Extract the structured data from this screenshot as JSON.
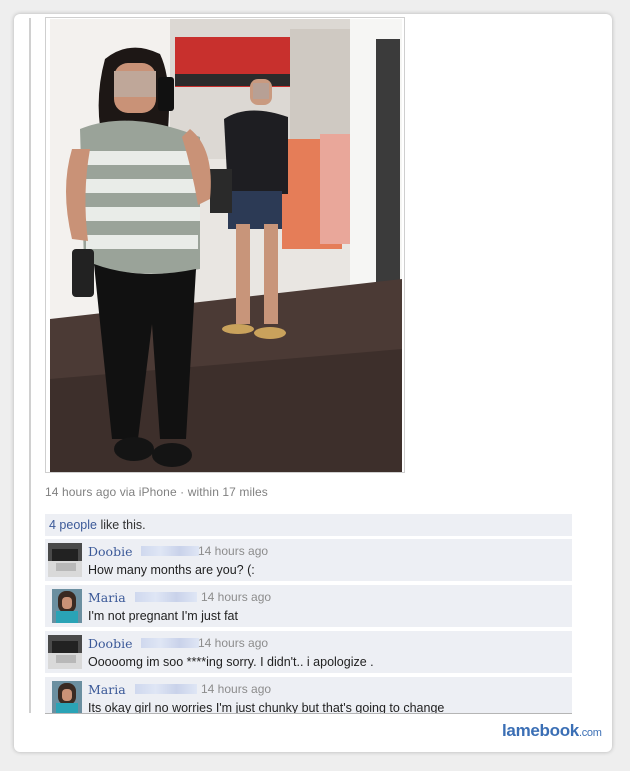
{
  "post": {
    "meta_text": "14 hours ago via iPhone · within 17 miles"
  },
  "likes": {
    "count_link": "4 people",
    "suffix": " like this."
  },
  "comments": [
    {
      "name": "Doobie",
      "time": "14 hours ago",
      "text": "How many months are you? (:"
    },
    {
      "name": "Maria",
      "time": "14 hours ago",
      "text": "I'm not pregnant I'm just fat"
    },
    {
      "name": "Doobie",
      "time": "14 hours ago",
      "text": "Ooooomg im soo ****ing sorry. I didn't.. i apologize ."
    },
    {
      "name": "Maria",
      "time": "14 hours ago",
      "text": "Its okay girl no worries I'm just chunky but that's going to change"
    }
  ],
  "brand": {
    "name": "lamebook",
    "suffix": ".com",
    "color": "#3b6fb5"
  },
  "colors": {
    "link": "#3b5998",
    "comment_bg": "#edeff4"
  }
}
